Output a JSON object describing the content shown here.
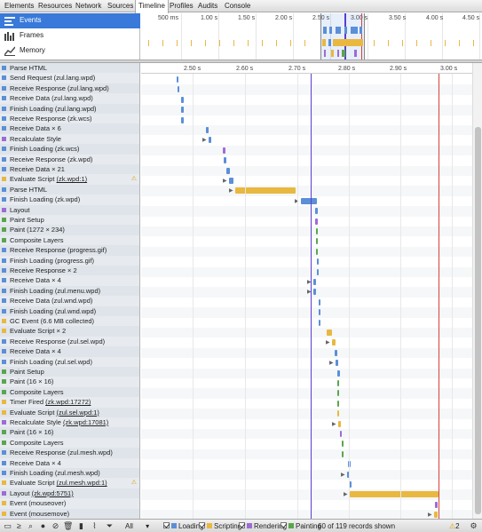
{
  "tabs": [
    {
      "label": "Elements",
      "active": false
    },
    {
      "label": "Resources",
      "active": false
    },
    {
      "label": "Network",
      "active": false
    },
    {
      "label": "Sources",
      "active": false
    },
    {
      "label": "Timeline",
      "active": true
    },
    {
      "label": "Profiles",
      "active": false
    },
    {
      "label": "Audits",
      "active": false
    },
    {
      "label": "Console",
      "active": false
    }
  ],
  "overview": {
    "items": [
      {
        "label": "Events",
        "icon": "events-icon",
        "selected": true
      },
      {
        "label": "Frames",
        "icon": "frames-icon",
        "selected": false
      },
      {
        "label": "Memory",
        "icon": "memory-icon",
        "selected": false
      }
    ],
    "ticks": [
      "500 ms",
      "1.00 s",
      "1.50 s",
      "2.00 s",
      "2.50 s",
      "3.00 s",
      "3.50 s",
      "4.00 s",
      "4.50 s"
    ]
  },
  "graph": {
    "ticks": [
      "2.50 s",
      "2.60 s",
      "2.70 s",
      "2.80 s",
      "2.90 s",
      "3.00 s"
    ]
  },
  "colors": {
    "loading": "#5b8fd8",
    "scripting": "#e9b840",
    "rendering": "#9e6bd6",
    "painting": "#5aa64e",
    "accent": "#3879d9"
  },
  "records": [
    {
      "label": "Parse HTML",
      "link": "",
      "cat": "loading"
    },
    {
      "label": "Send Request (zul.lang.wpd)",
      "link": "",
      "cat": "loading"
    },
    {
      "label": "Receive Response (zul.lang.wpd)",
      "link": "",
      "cat": "loading"
    },
    {
      "label": "Receive Data (zul.lang.wpd)",
      "link": "",
      "cat": "loading"
    },
    {
      "label": "Finish Loading (zul.lang.wpd)",
      "link": "",
      "cat": "loading"
    },
    {
      "label": "Receive Response (zk.wcs)",
      "link": "",
      "cat": "loading"
    },
    {
      "label": "Receive Data × 6",
      "link": "",
      "cat": "loading"
    },
    {
      "label": "Recalculate Style",
      "link": "",
      "cat": "rendering"
    },
    {
      "label": "Finish Loading (zk.wcs)",
      "link": "",
      "cat": "loading"
    },
    {
      "label": "Receive Response (zk.wpd)",
      "link": "",
      "cat": "loading"
    },
    {
      "label": "Receive Data × 21",
      "link": "",
      "cat": "loading"
    },
    {
      "label": "Evaluate Script ",
      "link": "(zk.wpd:1)",
      "cat": "scripting",
      "warn": true
    },
    {
      "label": "Parse HTML",
      "link": "",
      "cat": "loading"
    },
    {
      "label": "Finish Loading (zk.wpd)",
      "link": "",
      "cat": "loading"
    },
    {
      "label": "Layout",
      "link": "",
      "cat": "rendering"
    },
    {
      "label": "Paint Setup",
      "link": "",
      "cat": "painting"
    },
    {
      "label": "Paint (1272 × 234)",
      "link": "",
      "cat": "painting"
    },
    {
      "label": "Composite Layers",
      "link": "",
      "cat": "painting"
    },
    {
      "label": "Receive Response (progress.gif)",
      "link": "",
      "cat": "loading"
    },
    {
      "label": "Finish Loading (progress.gif)",
      "link": "",
      "cat": "loading"
    },
    {
      "label": "Receive Response × 2",
      "link": "",
      "cat": "loading"
    },
    {
      "label": "Receive Data × 4",
      "link": "",
      "cat": "loading"
    },
    {
      "label": "Finish Loading (zul.menu.wpd)",
      "link": "",
      "cat": "loading"
    },
    {
      "label": "Receive Data (zul.wnd.wpd)",
      "link": "",
      "cat": "loading"
    },
    {
      "label": "Finish Loading (zul.wnd.wpd)",
      "link": "",
      "cat": "loading"
    },
    {
      "label": "GC Event (6.6 MB collected)",
      "link": "",
      "cat": "scripting"
    },
    {
      "label": "Evaluate Script × 2",
      "link": "",
      "cat": "scripting"
    },
    {
      "label": "Receive Response (zul.sel.wpd)",
      "link": "",
      "cat": "loading"
    },
    {
      "label": "Receive Data × 4",
      "link": "",
      "cat": "loading"
    },
    {
      "label": "Finish Loading (zul.sel.wpd)",
      "link": "",
      "cat": "loading"
    },
    {
      "label": "Paint Setup",
      "link": "",
      "cat": "painting"
    },
    {
      "label": "Paint (16 × 16)",
      "link": "",
      "cat": "painting"
    },
    {
      "label": "Composite Layers",
      "link": "",
      "cat": "painting"
    },
    {
      "label": "Timer Fired ",
      "link": "(zk.wpd:17272)",
      "cat": "scripting"
    },
    {
      "label": "Evaluate Script ",
      "link": "(zul.sel.wpd:1)",
      "cat": "scripting"
    },
    {
      "label": "Recalculate Style ",
      "link": "(zk.wpd:17081)",
      "cat": "rendering"
    },
    {
      "label": "Paint (16 × 16)",
      "link": "",
      "cat": "painting"
    },
    {
      "label": "Composite Layers",
      "link": "",
      "cat": "painting"
    },
    {
      "label": "Receive Response (zul.mesh.wpd)",
      "link": "",
      "cat": "loading"
    },
    {
      "label": "Receive Data × 4",
      "link": "",
      "cat": "loading"
    },
    {
      "label": "Finish Loading (zul.mesh.wpd)",
      "link": "",
      "cat": "loading"
    },
    {
      "label": "Evaluate Script ",
      "link": "(zul.mesh.wpd:1)",
      "cat": "scripting",
      "warn": true
    },
    {
      "label": "Layout ",
      "link": "(zk.wpd:5751)",
      "cat": "rendering"
    },
    {
      "label": "Event (mouseover)",
      "link": "",
      "cat": "scripting"
    },
    {
      "label": "Event (mousemove)",
      "link": "",
      "cat": "scripting"
    }
  ],
  "status": {
    "filter_value": "All",
    "filters": [
      {
        "label": "Loading",
        "cat": "loading"
      },
      {
        "label": "Scripting",
        "cat": "scripting"
      },
      {
        "label": "Rendering",
        "cat": "rendering"
      },
      {
        "label": "Painting",
        "cat": "painting"
      }
    ],
    "records_count": "60 of 119 records shown",
    "warnings": "2"
  }
}
